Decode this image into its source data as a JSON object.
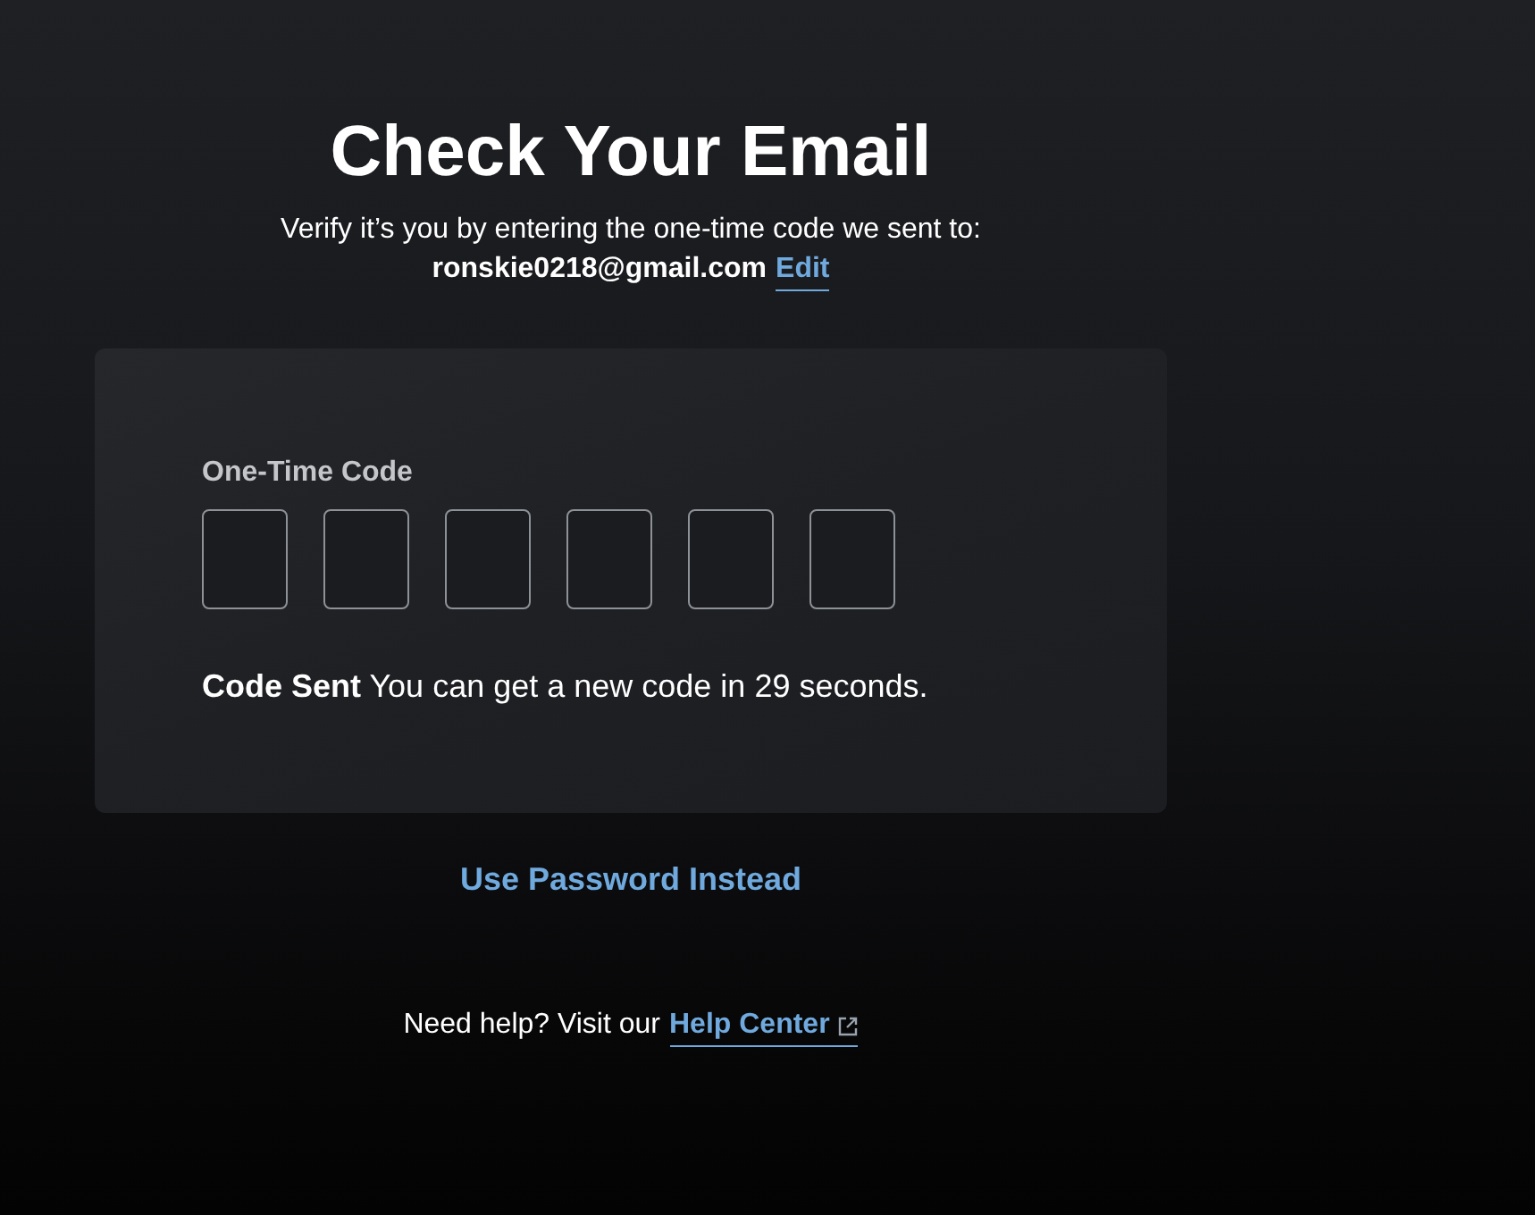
{
  "heading": {
    "title": "Check Your Email",
    "subtitle": "Verify it’s you by entering the one-time code we sent to:",
    "email": "ronskie0218@gmail.com",
    "edit_link": "Edit"
  },
  "code_card": {
    "label": "One-Time Code",
    "code_boxes": [
      {
        "kind": "digit"
      },
      {
        "kind": "digit"
      },
      {
        "kind": "digit"
      },
      {
        "kind": "digit"
      },
      {
        "kind": "digit"
      },
      {
        "kind": "digit"
      }
    ],
    "status": "**Code Sent** You can get a new code in 29 seconds."
  },
  "alt_action": "Use Password Instead",
  "help": {
    "text": "Need help? Visit our",
    "link": "Help Center"
  }
}
